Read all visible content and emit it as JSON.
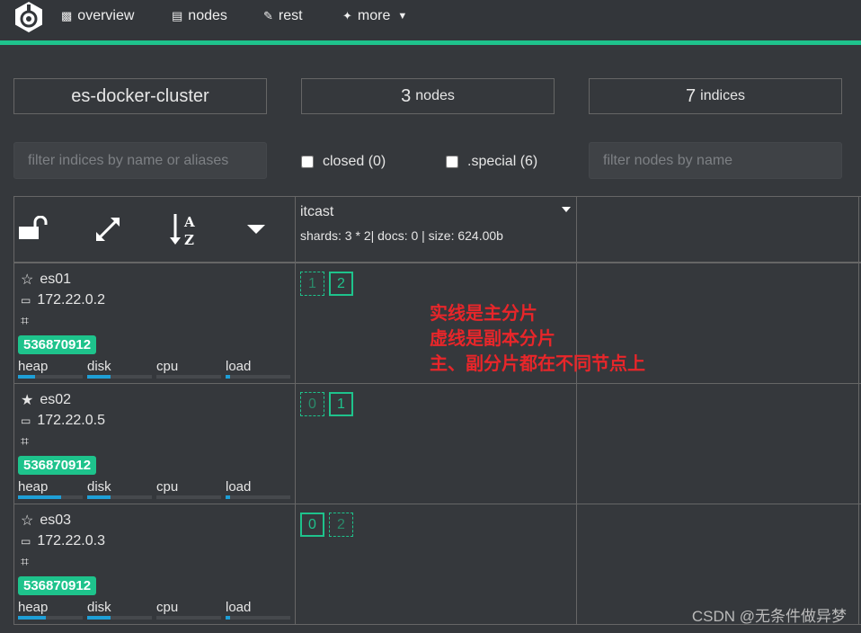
{
  "nav": {
    "items": [
      {
        "label": "overview",
        "icon": "sitemap-icon"
      },
      {
        "label": "nodes",
        "icon": "server-icon"
      },
      {
        "label": "rest",
        "icon": "edit-icon"
      },
      {
        "label": "more",
        "icon": "magic-wand-icon"
      }
    ]
  },
  "colors": {
    "accent": "#1ec38c",
    "bar": "#1e9fd7",
    "annotation": "#e8262a",
    "background": "#35383c"
  },
  "summary": {
    "cluster": "es-docker-cluster",
    "nodes_count": "3",
    "nodes_label": "nodes",
    "indices_count": "7",
    "indices_label": "indices"
  },
  "filters": {
    "indices_placeholder": "filter indices by name or aliases",
    "closed_label": "closed (0)",
    "special_label": ".special (6)",
    "nodes_placeholder": "filter nodes by name"
  },
  "index": {
    "name": "itcast",
    "meta": "shards: 3 * 2| docs: 0 | size: 624.00b"
  },
  "stat_labels": [
    "heap",
    "disk",
    "cpu",
    "load"
  ],
  "nodes": [
    {
      "name": "es01",
      "master": false,
      "ip": "172.22.0.2",
      "badge": "536870912",
      "stats": [
        26,
        36,
        0,
        7
      ],
      "shards": [
        {
          "n": "1",
          "primary": false
        },
        {
          "n": "2",
          "primary": true
        }
      ]
    },
    {
      "name": "es02",
      "master": true,
      "ip": "172.22.0.5",
      "badge": "536870912",
      "stats": [
        67,
        36,
        0,
        7
      ],
      "shards": [
        {
          "n": "0",
          "primary": false
        },
        {
          "n": "1",
          "primary": true
        }
      ]
    },
    {
      "name": "es03",
      "master": false,
      "ip": "172.22.0.3",
      "badge": "536870912",
      "stats": [
        43,
        36,
        0,
        7
      ],
      "shards": [
        {
          "n": "0",
          "primary": true
        },
        {
          "n": "2",
          "primary": false
        }
      ]
    }
  ],
  "annotation": [
    "实线是主分片",
    "虚线是副本分片",
    "主、副分片都在不同节点上"
  ],
  "watermark": "CSDN @无条件做异梦"
}
